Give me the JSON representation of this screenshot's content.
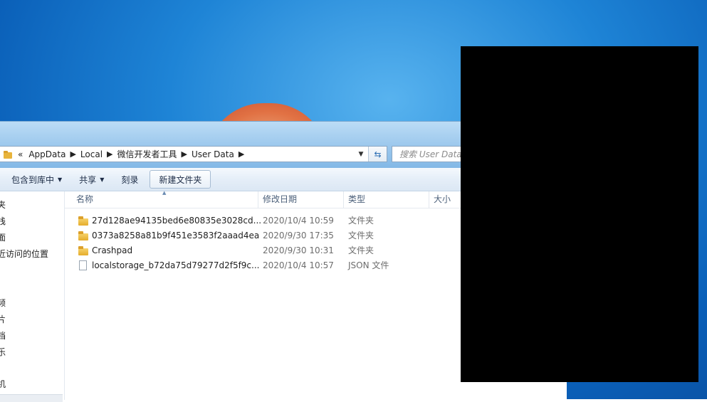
{
  "address_bar": {
    "overflow": "«",
    "crumbs": [
      "AppData",
      "Local",
      "微信开发者工具",
      "User Data"
    ],
    "separator": "▶"
  },
  "search": {
    "placeholder": "搜索 User Data"
  },
  "toolbar": {
    "include_library": "包含到库中",
    "share": "共享",
    "burn": "刻录",
    "new_folder": "新建文件夹"
  },
  "nav_pane": {
    "items": [
      "夹",
      "栈",
      "面",
      "近访问的位置",
      "频",
      "片",
      "档",
      "乐",
      "机"
    ]
  },
  "columns": {
    "name": "名称",
    "date": "修改日期",
    "type": "类型",
    "size": "大小"
  },
  "files": [
    {
      "name": "27d128ae94135bed6e80835e3028cd...",
      "date": "2020/10/4 10:59",
      "type": "文件夹",
      "icon": "folder-icon"
    },
    {
      "name": "0373a8258a81b9f451e3583f2aaad4ea",
      "date": "2020/9/30 17:35",
      "type": "文件夹",
      "icon": "folder-icon"
    },
    {
      "name": "Crashpad",
      "date": "2020/9/30 10:31",
      "type": "文件夹",
      "icon": "folder-icon"
    },
    {
      "name": "localstorage_b72da75d79277d2f5f9c...",
      "date": "2020/10/4 10:57",
      "type": "JSON 文件",
      "icon": "file-icon"
    }
  ],
  "colors": {
    "desktop": "#1e84d6",
    "accent": "#2a6db3"
  }
}
